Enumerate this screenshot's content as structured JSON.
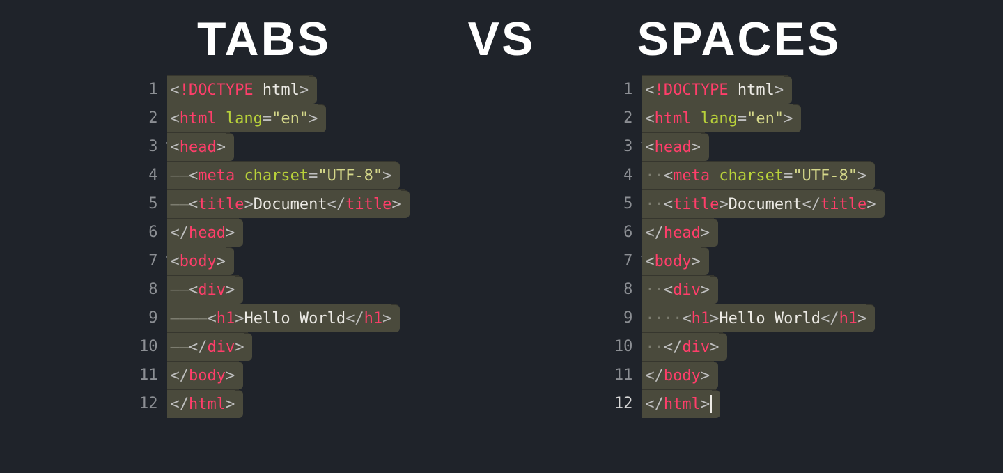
{
  "headings": {
    "left": "TABS",
    "middle": "VS",
    "right": "SPACES"
  },
  "line_numbers": [
    1,
    2,
    3,
    4,
    5,
    6,
    7,
    8,
    9,
    10,
    11,
    12
  ],
  "fold_lines": [
    3,
    7
  ],
  "current_line_right": 12,
  "left": {
    "label": "tabs",
    "indent_unit": "——",
    "lines": [
      [
        {
          "t": "<",
          "c": "punct"
        },
        {
          "t": "!DOCTYPE",
          "c": "tag"
        },
        {
          "t": " html",
          "c": "plain"
        },
        {
          "t": ">",
          "c": "punct"
        }
      ],
      [
        {
          "t": "<",
          "c": "punct"
        },
        {
          "t": "html",
          "c": "tag"
        },
        {
          "t": " ",
          "c": "plain"
        },
        {
          "t": "lang",
          "c": "attr"
        },
        {
          "t": "=",
          "c": "punct"
        },
        {
          "t": "\"en\"",
          "c": "str"
        },
        {
          "t": ">",
          "c": "punct"
        }
      ],
      [
        {
          "t": "<",
          "c": "punct"
        },
        {
          "t": "head",
          "c": "tag"
        },
        {
          "t": ">",
          "c": "punct"
        }
      ],
      [
        {
          "t": "——",
          "c": "ig"
        },
        {
          "t": "<",
          "c": "punct"
        },
        {
          "t": "meta",
          "c": "tag"
        },
        {
          "t": " ",
          "c": "plain"
        },
        {
          "t": "charset",
          "c": "attr"
        },
        {
          "t": "=",
          "c": "punct"
        },
        {
          "t": "\"UTF-8\"",
          "c": "str"
        },
        {
          "t": ">",
          "c": "punct"
        }
      ],
      [
        {
          "t": "——",
          "c": "ig"
        },
        {
          "t": "<",
          "c": "punct"
        },
        {
          "t": "title",
          "c": "tag"
        },
        {
          "t": ">",
          "c": "punct"
        },
        {
          "t": "Document",
          "c": "plain"
        },
        {
          "t": "</",
          "c": "punct"
        },
        {
          "t": "title",
          "c": "tag"
        },
        {
          "t": ">",
          "c": "punct"
        }
      ],
      [
        {
          "t": "</",
          "c": "punct"
        },
        {
          "t": "head",
          "c": "tag"
        },
        {
          "t": ">",
          "c": "punct"
        }
      ],
      [
        {
          "t": "<",
          "c": "punct"
        },
        {
          "t": "body",
          "c": "tag"
        },
        {
          "t": ">",
          "c": "punct"
        }
      ],
      [
        {
          "t": "——",
          "c": "ig"
        },
        {
          "t": "<",
          "c": "punct"
        },
        {
          "t": "div",
          "c": "tag"
        },
        {
          "t": ">",
          "c": "punct"
        }
      ],
      [
        {
          "t": "——",
          "c": "ig"
        },
        {
          "t": "——",
          "c": "ig"
        },
        {
          "t": "<",
          "c": "punct"
        },
        {
          "t": "h1",
          "c": "tag"
        },
        {
          "t": ">",
          "c": "punct"
        },
        {
          "t": "Hello World",
          "c": "plain"
        },
        {
          "t": "</",
          "c": "punct"
        },
        {
          "t": "h1",
          "c": "tag"
        },
        {
          "t": ">",
          "c": "punct"
        }
      ],
      [
        {
          "t": "——",
          "c": "ig"
        },
        {
          "t": "</",
          "c": "punct"
        },
        {
          "t": "div",
          "c": "tag"
        },
        {
          "t": ">",
          "c": "punct"
        }
      ],
      [
        {
          "t": "</",
          "c": "punct"
        },
        {
          "t": "body",
          "c": "tag"
        },
        {
          "t": ">",
          "c": "punct"
        }
      ],
      [
        {
          "t": "</",
          "c": "punct"
        },
        {
          "t": "html",
          "c": "tag"
        },
        {
          "t": ">",
          "c": "punct"
        }
      ]
    ]
  },
  "right": {
    "label": "spaces",
    "indent_unit": "··",
    "lines": [
      [
        {
          "t": "<",
          "c": "punct"
        },
        {
          "t": "!DOCTYPE",
          "c": "tag"
        },
        {
          "t": " html",
          "c": "plain"
        },
        {
          "t": ">",
          "c": "punct"
        }
      ],
      [
        {
          "t": "<",
          "c": "punct"
        },
        {
          "t": "html",
          "c": "tag"
        },
        {
          "t": " ",
          "c": "plain"
        },
        {
          "t": "lang",
          "c": "attr"
        },
        {
          "t": "=",
          "c": "punct"
        },
        {
          "t": "\"en\"",
          "c": "str"
        },
        {
          "t": ">",
          "c": "punct"
        }
      ],
      [
        {
          "t": "<",
          "c": "punct"
        },
        {
          "t": "head",
          "c": "tag"
        },
        {
          "t": ">",
          "c": "punct"
        }
      ],
      [
        {
          "t": "··",
          "c": "ig"
        },
        {
          "t": "<",
          "c": "punct"
        },
        {
          "t": "meta",
          "c": "tag"
        },
        {
          "t": " ",
          "c": "plain"
        },
        {
          "t": "charset",
          "c": "attr"
        },
        {
          "t": "=",
          "c": "punct"
        },
        {
          "t": "\"UTF-8\"",
          "c": "str"
        },
        {
          "t": ">",
          "c": "punct"
        }
      ],
      [
        {
          "t": "··",
          "c": "ig"
        },
        {
          "t": "<",
          "c": "punct"
        },
        {
          "t": "title",
          "c": "tag"
        },
        {
          "t": ">",
          "c": "punct"
        },
        {
          "t": "Document",
          "c": "plain"
        },
        {
          "t": "</",
          "c": "punct"
        },
        {
          "t": "title",
          "c": "tag"
        },
        {
          "t": ">",
          "c": "punct"
        }
      ],
      [
        {
          "t": "</",
          "c": "punct"
        },
        {
          "t": "head",
          "c": "tag"
        },
        {
          "t": ">",
          "c": "punct"
        }
      ],
      [
        {
          "t": "<",
          "c": "punct"
        },
        {
          "t": "body",
          "c": "tag"
        },
        {
          "t": ">",
          "c": "punct"
        }
      ],
      [
        {
          "t": "··",
          "c": "ig"
        },
        {
          "t": "<",
          "c": "punct"
        },
        {
          "t": "div",
          "c": "tag"
        },
        {
          "t": ">",
          "c": "punct"
        }
      ],
      [
        {
          "t": "··",
          "c": "ig"
        },
        {
          "t": "··",
          "c": "ig"
        },
        {
          "t": "<",
          "c": "punct"
        },
        {
          "t": "h1",
          "c": "tag"
        },
        {
          "t": ">",
          "c": "punct"
        },
        {
          "t": "Hello World",
          "c": "plain"
        },
        {
          "t": "</",
          "c": "punct"
        },
        {
          "t": "h1",
          "c": "tag"
        },
        {
          "t": ">",
          "c": "punct"
        }
      ],
      [
        {
          "t": "··",
          "c": "ig"
        },
        {
          "t": "</",
          "c": "punct"
        },
        {
          "t": "div",
          "c": "tag"
        },
        {
          "t": ">",
          "c": "punct"
        }
      ],
      [
        {
          "t": "</",
          "c": "punct"
        },
        {
          "t": "body",
          "c": "tag"
        },
        {
          "t": ">",
          "c": "punct"
        }
      ],
      [
        {
          "t": "</",
          "c": "punct"
        },
        {
          "t": "html",
          "c": "tag"
        },
        {
          "t": ">",
          "c": "punct"
        }
      ]
    ]
  }
}
